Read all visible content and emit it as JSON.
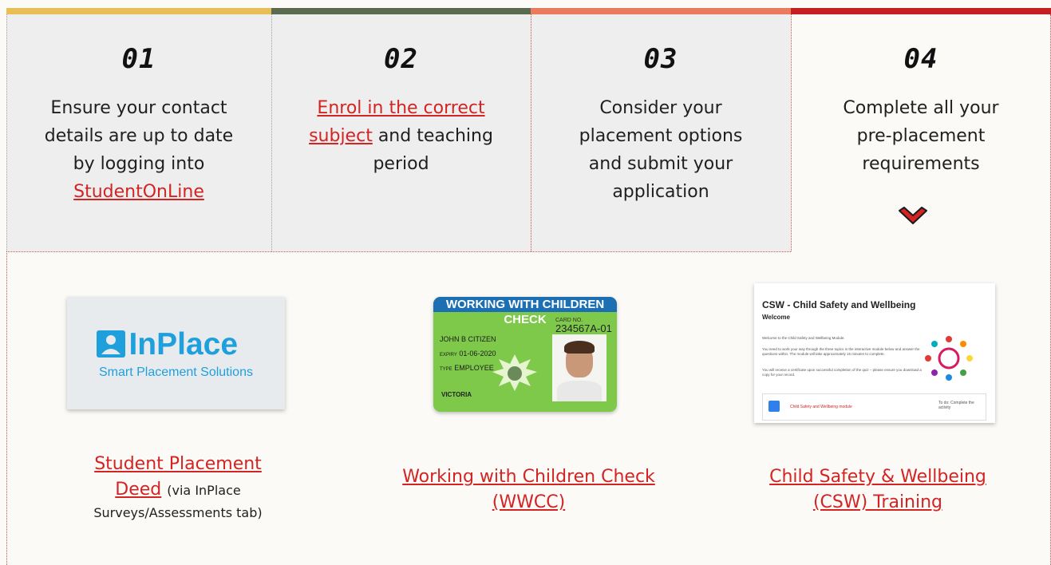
{
  "colors": {
    "bar1": "#e8be56",
    "bar2": "#5a6b4f",
    "bar3": "#ec7a5c",
    "bar4": "#c41d22",
    "link": "#d32424",
    "chevron": "#d32424"
  },
  "steps": [
    {
      "number": "01",
      "lines": [
        "Ensure your contact",
        "details are up to date",
        "by logging into"
      ],
      "link": "StudentOnLine"
    },
    {
      "number": "02",
      "link_line1": "Enrol in the correct",
      "link_line2": "subject",
      "after_link": " and teaching",
      "line3": "period"
    },
    {
      "number": "03",
      "lines": [
        "Consider your",
        "placement options",
        "and submit your",
        "application"
      ]
    },
    {
      "number": "04",
      "lines": [
        "Complete all your",
        "pre-placement",
        "requirements"
      ],
      "icon": "chevron-down-icon"
    }
  ],
  "requirements": {
    "inplace": {
      "logo_text": "InPlace",
      "tagline": "Smart Placement Solutions",
      "link_line1": "Student Placement",
      "link_line2": "Deed",
      "note1": "(via InPlace",
      "note2": "Surveys/Assessments tab)"
    },
    "wwcc": {
      "card_header": "WORKING WITH CHILDREN CHECK",
      "card_no_label": "CARD NO.",
      "card_no": "234567A-01",
      "name": "JOHN B CITIZEN",
      "expiry_label": "EXPIRY",
      "expiry": "01-06-2020",
      "type_label": "TYPE",
      "type": "EMPLOYEE",
      "state": "VICTORIA",
      "link_line1": "Working with Children Check",
      "link_line2": "(WWCC)"
    },
    "csw": {
      "title": "CSW - Child Safety and Wellbeing",
      "welcome": "Welcome",
      "p1": "Welcome to the Child Safety and Wellbeing Module.",
      "p2": "You need to work your way through the three topics in the interactive module below and answer the questions within. The module will take approximately 15 minutes to complete.",
      "p3": "You will receive a certificate upon successful completion of the quiz – please ensure you download a copy for your record.",
      "module_label": "Child Safety and Wellbeing module",
      "todo": "To do: Complete the activity",
      "link_line1": "Child Safety & Wellbeing",
      "link_line2": "(CSW) Training"
    }
  }
}
